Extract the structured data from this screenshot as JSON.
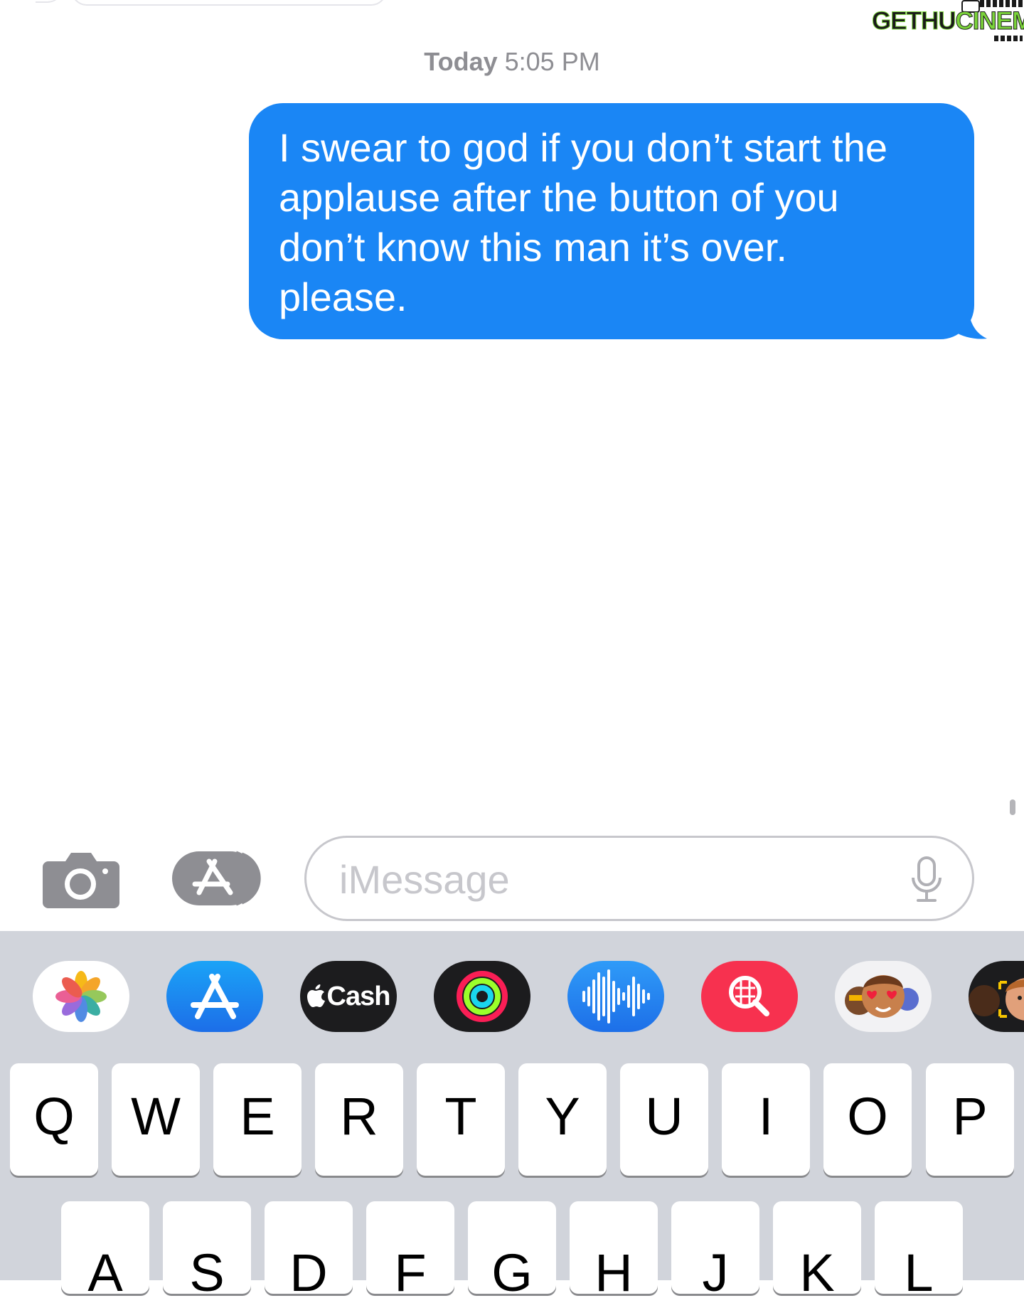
{
  "watermark": {
    "left": "GETHU",
    "right": "CINEMA"
  },
  "conversation": {
    "timestamp_day": "Today",
    "timestamp_time": "5:05 PM",
    "sent_message": "I swear to god if you don’t start the\napplause after the button of you\ndon’t know this man it’s over.\nplease."
  },
  "composer": {
    "placeholder": "iMessage",
    "icons": [
      "camera-icon",
      "app-store-icon",
      "microphone-icon"
    ]
  },
  "app_tray": {
    "apps": [
      "photos-icon",
      "app-store-icon",
      "apple-cash-icon",
      "activity-icon",
      "audio-message-icon",
      "images-search-icon",
      "memoji-stickers-icon",
      "memoji-icon"
    ],
    "cash_label": "Cash"
  },
  "keyboard": {
    "row1": [
      "Q",
      "W",
      "E",
      "R",
      "T",
      "Y",
      "U",
      "I",
      "O",
      "P"
    ],
    "row2": [
      "A",
      "S",
      "D",
      "F",
      "G",
      "H",
      "J",
      "K",
      "L"
    ]
  },
  "colors": {
    "sent_bubble": "#1a86f5",
    "tray_background": "#d1d4db",
    "timestamp": "#8e8e93"
  }
}
